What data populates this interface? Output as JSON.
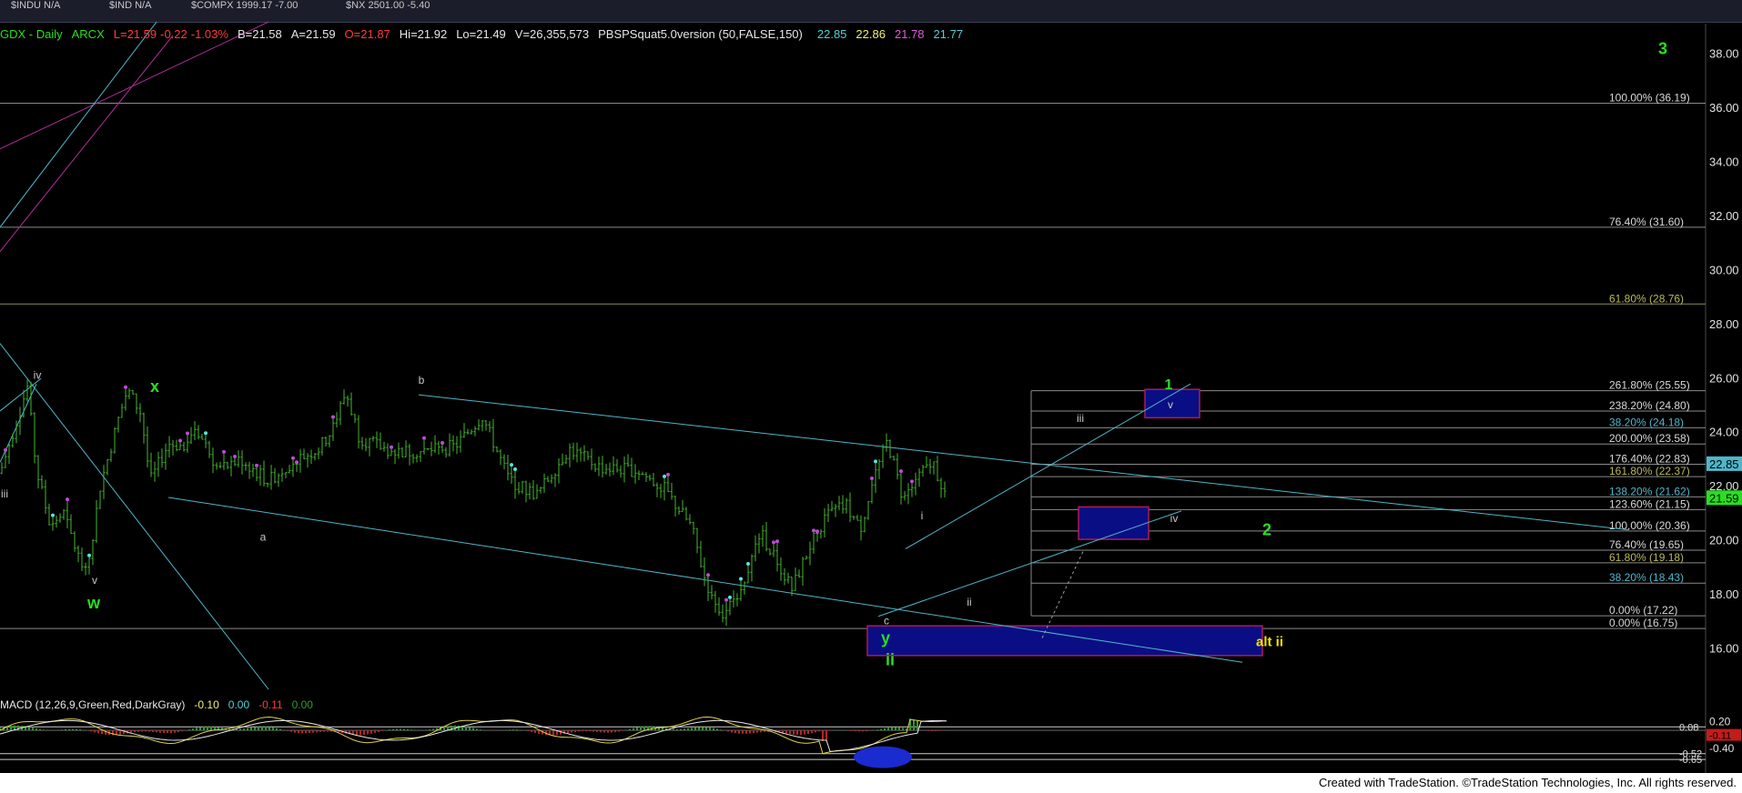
{
  "topbar": {
    "items": [
      "$INDU N/A",
      "$IND N/A",
      "$COMPX 1999.17 -7.00",
      "$NX 2501.00 -5.40"
    ]
  },
  "header": {
    "symbol": "GDX - Daily",
    "exchange": "ARCX",
    "last": "L=21.59",
    "change": "-0.22",
    "pct": "-1.03%",
    "bid": "B=21.58",
    "ask": "A=21.59",
    "open": "O=21.87",
    "high": "Hi=21.92",
    "low": "Lo=21.49",
    "volume": "V=26,355,573",
    "indicator": "PBSPSquat5.0version (50,FALSE,150)",
    "ind_values": [
      "22.85",
      "22.86",
      "21.78",
      "21.77"
    ]
  },
  "macd_header": {
    "label": "MACD (12,26,9,Green,Red,DarkGray)",
    "values": [
      "-0.10",
      "0.00",
      "-0.11",
      "0.00"
    ]
  },
  "footer": "Created with TradeStation. ©TradeStation Technologies, Inc. All rights reserved.",
  "colors": {
    "background": "#000000",
    "candle": "#46b52e",
    "wave_label_green": "#27e01e",
    "wave_label_yellow": "#f2e500",
    "trend_line": "#4fb6c9",
    "fib_line": "#8a8a8a",
    "box_fill": "#0a0e84",
    "box_border": "#b0195c",
    "macd_line": "#e0d24a",
    "signal_line": "#e8e8e8",
    "hist_pos": "#2f9a2f",
    "hist_neg": "#b42525"
  },
  "chart_data": {
    "type": "candlestick",
    "title": "GDX - Daily",
    "ylim": [
      14.5,
      39
    ],
    "y_ticks": [
      16,
      18,
      20,
      22,
      24,
      26,
      28,
      30,
      32,
      34,
      36,
      38
    ],
    "y_tick_labels": [
      "16.00",
      "18.00",
      "20.00",
      "22.00",
      "24.00",
      "26.00",
      "28.00",
      "30.00",
      "32.00",
      "34.00",
      "36.00",
      "38.00"
    ],
    "price_path": [
      [
        "0",
        22.5
      ],
      [
        "30",
        25.7
      ],
      [
        "40",
        22.6
      ],
      [
        "55",
        20.6
      ],
      [
        "70",
        21.0
      ],
      [
        "85",
        19.5
      ],
      [
        "95",
        18.7
      ],
      [
        "110",
        22.0
      ],
      [
        "130",
        24.5
      ],
      [
        "140",
        25.6
      ],
      [
        "155",
        24.7
      ],
      [
        "165",
        22.2
      ],
      [
        "185",
        23.6
      ],
      [
        "200",
        23.5
      ],
      [
        "215",
        24.2
      ],
      [
        "240",
        22.6
      ],
      [
        "265",
        23.0
      ],
      [
        "295",
        22.2
      ],
      [
        "320",
        22.9
      ],
      [
        "350",
        23.4
      ],
      [
        "365",
        24.1
      ],
      [
        "380",
        25.5
      ],
      [
        "395",
        23.8
      ],
      [
        "430",
        23.3
      ],
      [
        "470",
        23.3
      ],
      [
        "500",
        23.5
      ],
      [
        "530",
        24.6
      ],
      [
        "560",
        22.2
      ],
      [
        "590",
        21.7
      ],
      [
        "625",
        23.4
      ],
      [
        "660",
        22.7
      ],
      [
        "700",
        22.6
      ],
      [
        "730",
        21.9
      ],
      [
        "760",
        20.5
      ],
      [
        "775",
        18.5
      ],
      [
        "795",
        17.2
      ],
      [
        "820",
        18.7
      ],
      [
        "835",
        20.3
      ],
      [
        "850",
        19.5
      ],
      [
        "870",
        18.2
      ],
      [
        "890",
        19.8
      ],
      [
        "910",
        21.0
      ],
      [
        "930",
        21.3
      ],
      [
        "945",
        20.4
      ],
      [
        "960",
        22.3
      ],
      [
        "975",
        23.7
      ],
      [
        "990",
        21.8
      ],
      [
        "1010",
        22.4
      ],
      [
        "1025",
        22.9
      ],
      [
        "1040",
        21.6
      ]
    ],
    "fib_levels": [
      {
        "label": "100.00% (36.19)",
        "value": 36.19
      },
      {
        "label": "76.40% (31.60)",
        "value": 31.6
      },
      {
        "label": "61.80% (28.76)",
        "value": 28.76
      },
      {
        "label": "261.80% (25.55)",
        "value": 25.55
      },
      {
        "label": "238.20% (24.80)",
        "value": 24.8
      },
      {
        "label": "38.20% (24.18)",
        "value": 24.18
      },
      {
        "label": "200.00% (23.58)",
        "value": 23.58
      },
      {
        "label": "176.40% (22.83)",
        "value": 22.83
      },
      {
        "label": "161.80% (22.37)",
        "value": 22.37
      },
      {
        "label": "138.20% (21.62)",
        "value": 21.62
      },
      {
        "label": "123.60% (21.15)",
        "value": 21.15
      },
      {
        "label": "100.00% (20.36)",
        "value": 20.36
      },
      {
        "label": "76.40% (19.65)",
        "value": 19.65
      },
      {
        "label": "61.80% (19.18)",
        "value": 19.18
      },
      {
        "label": "38.20% (18.43)",
        "value": 18.43
      },
      {
        "label": "0.00% (17.22)",
        "value": 17.22
      },
      {
        "label": "0.00% (16.75)",
        "value": 16.75
      }
    ],
    "price_tags": [
      {
        "label": "22.85",
        "value": 22.85,
        "color": "#4fb6c9"
      },
      {
        "label": "21.59",
        "value": 21.59,
        "color": "#27e01e"
      }
    ],
    "wave_labels": [
      {
        "text": "3",
        "x": "1827",
        "y": 38.0,
        "color": "green",
        "size": 18
      },
      {
        "text": "1",
        "x": "1284",
        "y": 25.6,
        "color": "green",
        "size": 16
      },
      {
        "text": "2",
        "x": "1392",
        "y": 20.2,
        "color": "green",
        "size": 18
      },
      {
        "text": "x",
        "x": "170",
        "y": 25.5,
        "color": "green",
        "size": 18
      },
      {
        "text": "w",
        "x": "103",
        "y": 17.5,
        "color": "green",
        "size": 18
      },
      {
        "text": "y",
        "x": "973",
        "y": 16.2,
        "color": "green",
        "size": 18
      },
      {
        "text": "ii",
        "x": "978",
        "y": 15.4,
        "color": "green",
        "size": 18
      },
      {
        "text": "alt ii",
        "x": "1395",
        "y": 16.1,
        "color": "yellow",
        "size": 15
      },
      {
        "text": "iv",
        "x": "41",
        "y": 26.0,
        "color": "grey",
        "size": 12
      },
      {
        "text": "iii",
        "x": "5",
        "y": 21.6,
        "color": "grey",
        "size": 12
      },
      {
        "text": "v",
        "x": "104",
        "y": 18.4,
        "color": "grey",
        "size": 12
      },
      {
        "text": "b",
        "x": "463",
        "y": 25.8,
        "color": "grey",
        "size": 12
      },
      {
        "text": "a",
        "x": "289",
        "y": 20.0,
        "color": "grey",
        "size": 12
      },
      {
        "text": "c",
        "x": "974",
        "y": 16.9,
        "color": "grey",
        "size": 12
      },
      {
        "text": "i",
        "x": "1013",
        "y": 20.8,
        "color": "grey",
        "size": 12
      },
      {
        "text": "ii",
        "x": "1065",
        "y": 17.6,
        "color": "grey",
        "size": 12
      },
      {
        "text": "iii",
        "x": "1187",
        "y": 24.4,
        "color": "grey",
        "size": 12
      },
      {
        "text": "iv",
        "x": "1290",
        "y": 20.7,
        "color": "grey",
        "size": 12
      },
      {
        "text": "v",
        "x": "1286",
        "y": 24.9,
        "color": "grey",
        "size": 12
      }
    ],
    "macd": {
      "ylim": [
        -0.75,
        0.35
      ],
      "y_ticks": [
        0.2,
        -0.4
      ],
      "y_tick_labels": [
        "0.20",
        "-0.40"
      ],
      "tags": [
        {
          "label": "0.08",
          "value": 0.08
        },
        {
          "label": "-0.11",
          "value": -0.11
        },
        {
          "label": "-0.52",
          "value": -0.52
        },
        {
          "label": "-0.65",
          "value": -0.65
        }
      ]
    }
  }
}
